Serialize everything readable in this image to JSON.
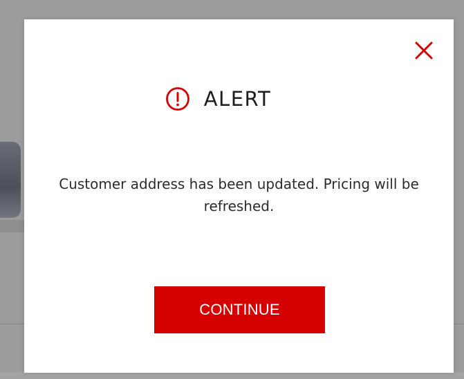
{
  "modal": {
    "title": "ALERT",
    "message": "Customer address has been updated. Pricing will be refreshed.",
    "continue_label": "CONTINUE",
    "close_icon": "close-icon",
    "alert_icon": "exclamation-circle-icon"
  },
  "colors": {
    "accent": "#d50000",
    "overlay": "#9c9c9c",
    "text": "#1d1d1d"
  }
}
